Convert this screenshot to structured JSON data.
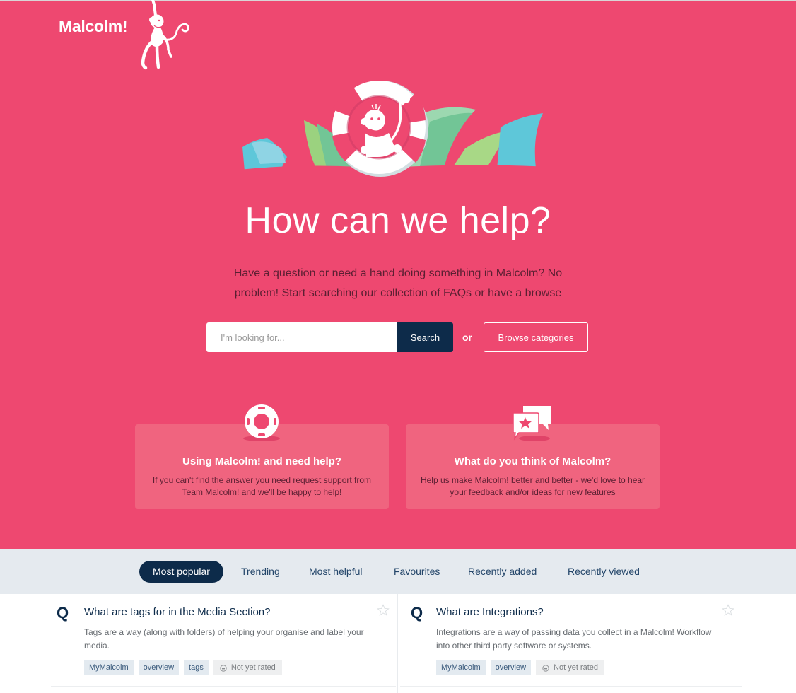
{
  "brand": {
    "name": "Malcolm!",
    "accent_color": "#ee4870",
    "dark_color": "#0d2b4a"
  },
  "hero": {
    "headline": "How can we help?",
    "subtext": "Have a question or need a hand doing something in Malcolm? No problem! Start searching our collection of FAQs or have a browse"
  },
  "search": {
    "placeholder": "I'm looking for...",
    "value": "",
    "button_label": "Search",
    "or_label": "or",
    "browse_label": "Browse categories"
  },
  "cards": [
    {
      "icon": "lifebuoy-icon",
      "title": "Using Malcolm! and need help?",
      "description": "If you can't find the answer you need request support from Team Malcolm! and we'll be happy to help!"
    },
    {
      "icon": "chat-bubbles-star-icon",
      "title": "What do you think of Malcolm?",
      "description": "Help us make Malcolm! better and better - we'd love to hear your feedback and/or ideas for new features"
    }
  ],
  "tabs": [
    {
      "label": "Most popular",
      "active": true
    },
    {
      "label": "Trending",
      "active": false
    },
    {
      "label": "Most helpful",
      "active": false
    },
    {
      "label": "Favourites",
      "active": false
    },
    {
      "label": "Recently added",
      "active": false
    },
    {
      "label": "Recently viewed",
      "active": false
    }
  ],
  "faqs": [
    {
      "q_marker": "Q",
      "title": "What are tags for in the Media Section?",
      "description": "Tags are a way (along with folders) of helping your organise and label your media.",
      "tags": [
        "MyMalcolm",
        "overview",
        "tags"
      ],
      "rating": "Not yet rated",
      "favourited": false
    },
    {
      "q_marker": "Q",
      "title": "What are Integrations?",
      "description": "Integrations are a way of passing data you collect in a Malcolm! Workflow into other third party software or systems.",
      "tags": [
        "MyMalcolm",
        "overview"
      ],
      "rating": "Not yet rated",
      "favourited": false
    }
  ]
}
